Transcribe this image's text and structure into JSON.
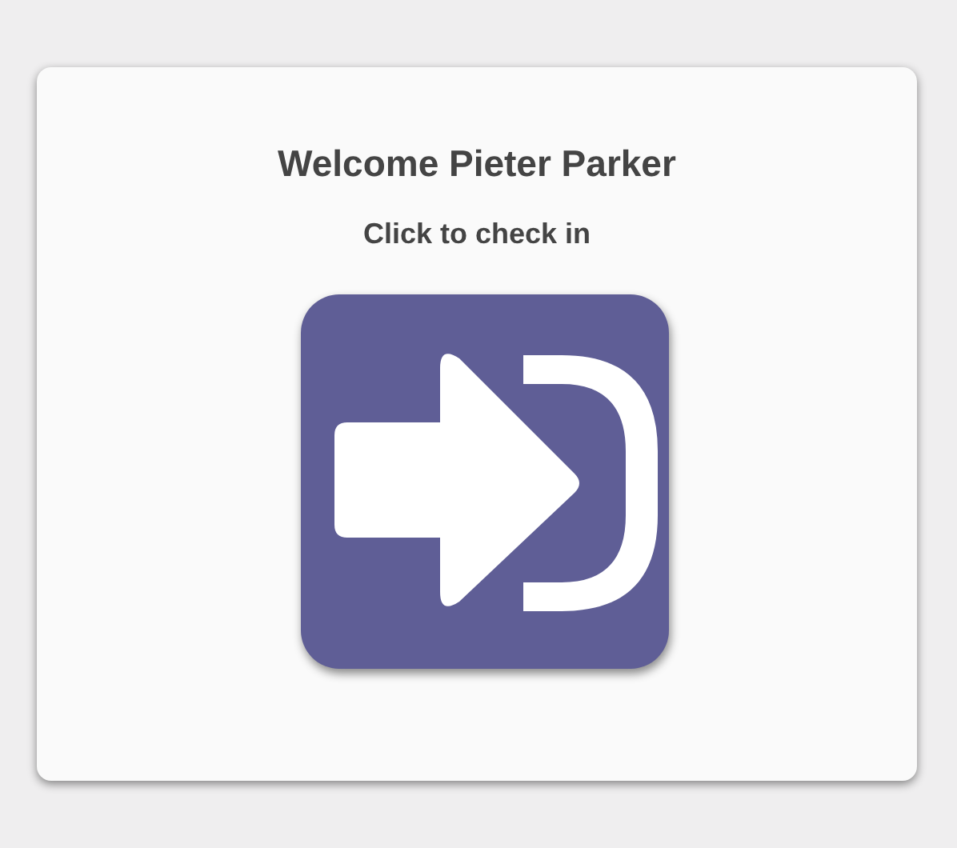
{
  "card": {
    "title": "Welcome Pieter Parker",
    "subtitle": "Click to check in"
  }
}
